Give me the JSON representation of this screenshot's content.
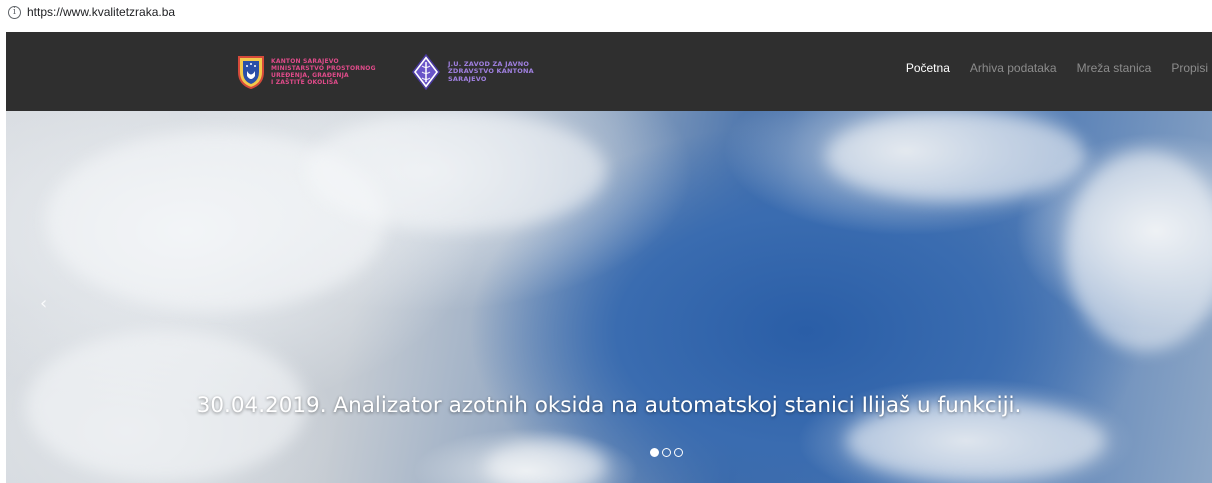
{
  "browser": {
    "url": "https://www.kvalitetzraka.ba"
  },
  "header": {
    "logo1": {
      "lines": [
        "KANTON SARAJEVO",
        "MINISTARSTVO PROSTORNOG",
        "UREĐENJA, GRAĐENJA",
        "I ZAŠTITE OKOLIŠA"
      ]
    },
    "logo2": {
      "lines": [
        "J.U. ZAVOD ZA JAVNO",
        "ZDRAVSTVO KANTONA",
        "SARAJEVO"
      ]
    },
    "nav": [
      {
        "label": "Početna",
        "active": true
      },
      {
        "label": "Arhiva podataka",
        "active": false
      },
      {
        "label": "Mreža stanica",
        "active": false
      },
      {
        "label": "Propisi",
        "active": false
      }
    ]
  },
  "carousel": {
    "prev_glyph": "‹",
    "caption": "30.04.2019. Analizator azotnih oksida na automatskoj stanici Ilijaš u funkciji.",
    "slides_count": 3,
    "active_slide": 1
  },
  "colors": {
    "header_bg": "#2f2f2f",
    "nav_active": "#ffffff",
    "nav_inactive": "#8c8c8c",
    "logo1_text": "#e04b8a",
    "logo2_text": "#a080e0"
  }
}
